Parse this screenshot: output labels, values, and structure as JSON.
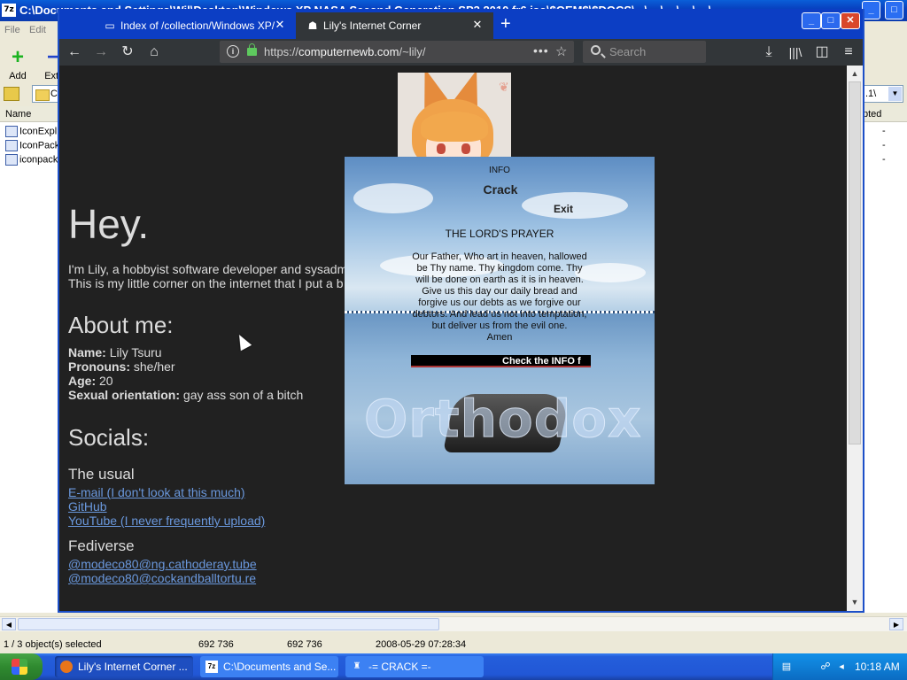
{
  "zip": {
    "title": "C:\\Documents and Settings\\Wil\\Desktop\\Windows XP NASA Second Generation SP3 2010 fr6 iso\\$OEM$\\$DOCS\\...\\ ...\\ ...\\ ...\\ ...\\ ...",
    "menu": [
      "File",
      "Edit"
    ],
    "tools": [
      {
        "label": "Add",
        "icon": "plus-icon",
        "glyph": "+"
      },
      {
        "label": "Extr",
        "icon": "minus-icon",
        "glyph": "−"
      }
    ],
    "address_fragment": "C",
    "address_right": ".1\\",
    "columns": {
      "name": "Name",
      "right": "pted"
    },
    "files": [
      {
        "name": "IconExpl",
        "flag": "-"
      },
      {
        "name": "IconPack",
        "flag": "-"
      },
      {
        "name": "iconpack",
        "flag": "-"
      }
    ],
    "status": {
      "selected": "1 / 3 object(s) selected",
      "size": "692 736",
      "packed": "692 736",
      "modified": "2008-05-29 07:28:34"
    }
  },
  "browser": {
    "tabs": [
      {
        "label": "Index of /collection/Windows XP/",
        "icon": "folder-icon",
        "active": false
      },
      {
        "label": "Lily's Internet Corner",
        "icon": "page-icon",
        "active": true
      }
    ],
    "url_prefix": "https://",
    "url_host": "computernewb.com",
    "url_path": "/~lily/",
    "search_placeholder": "Search"
  },
  "page": {
    "heading": "Hey.",
    "intro_line1": "I'm Lily, a hobbyist software developer and sysadm",
    "intro_line2": "This is my little corner on the internet that I put a b",
    "about_heading": "About me:",
    "about": [
      {
        "key": "Name:",
        "value": "Lily Tsuru"
      },
      {
        "key": "Pronouns:",
        "value": "she/her"
      },
      {
        "key": "Age:",
        "value": "20"
      },
      {
        "key": "Sexual orientation:",
        "value": "gay ass son of a bitch"
      }
    ],
    "socials_heading": "Socials:",
    "usual_heading": "The usual",
    "usual_links": [
      "E-mail (I don't look at this much)",
      "GitHub",
      "YouTube (I never frequently upload)"
    ],
    "fediverse_heading": "Fediverse",
    "fediverse_links": [
      "@modeco80@ng.cathoderay.tube",
      "@modeco80@cockandballtortu.re"
    ]
  },
  "popup": {
    "info": "INFO",
    "title": "Crack",
    "exit": "Exit",
    "prayer_title": "THE LORD'S PRAYER",
    "prayer_text": "Our Father, Who art in heaven, hallowed be Thy name. Thy kingdom come. Thy will be done on earth as it is in heaven. Give us this day our daily bread and forgive us our debts as we forgive our debtors. And lead us not into temptation, but deliver us from the evil one.",
    "amen": "Amen",
    "marquee": "Check the INFO f",
    "watermark": "Orthodox"
  },
  "taskbar": {
    "buttons": [
      {
        "label": "Lily's Internet Corner ...",
        "icon": "firefox-icon"
      },
      {
        "label": "C:\\Documents and Se...",
        "icon": "7zip-icon"
      },
      {
        "label": "-= CRACK =-",
        "icon": "crack-icon"
      }
    ],
    "clock": "10:18 AM"
  }
}
